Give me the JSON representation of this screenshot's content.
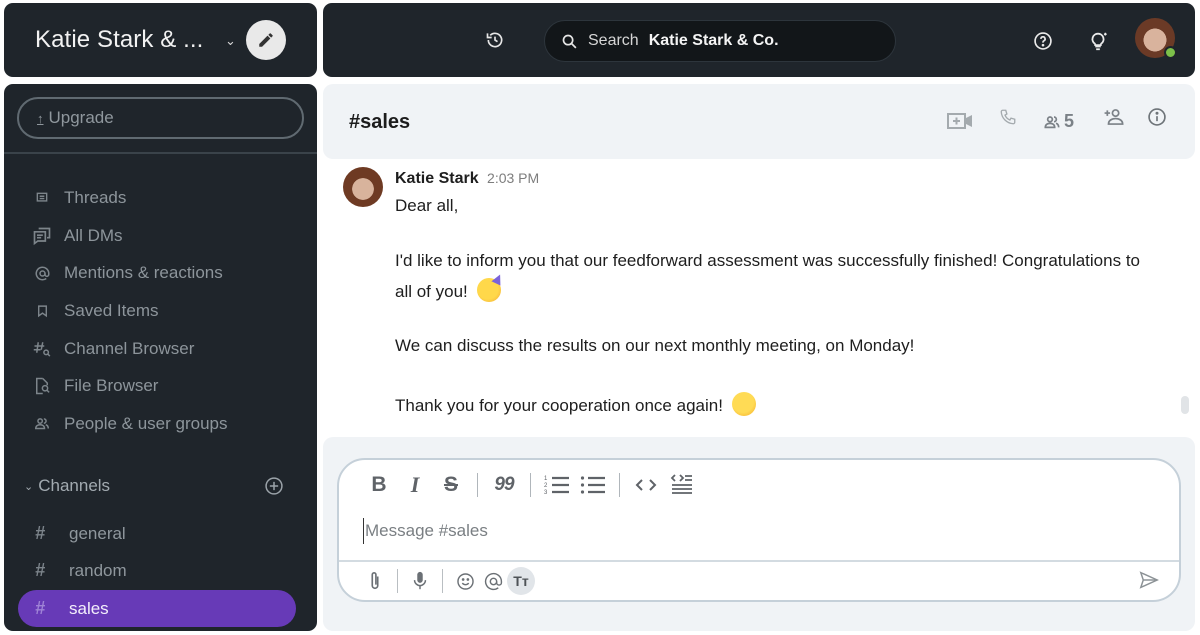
{
  "workspace": {
    "name": "Katie Stark & ...",
    "dropdown_icon": "chevron-down-icon",
    "edit_icon": "pencil-icon"
  },
  "topbar": {
    "history_icon": "history-icon",
    "search_label": "Search",
    "search_scope": "Katie Stark & Co.",
    "help_icon": "help-circle-icon",
    "whats_new_icon": "lightbulb-icon",
    "user_status": "online"
  },
  "sidebar": {
    "upgrade_label": "Upgrade",
    "nav_items": [
      {
        "label": "Threads",
        "icon": "threads-icon"
      },
      {
        "label": "All DMs",
        "icon": "direct-messages-icon"
      },
      {
        "label": "Mentions & reactions",
        "icon": "at-sign-icon"
      },
      {
        "label": "Saved Items",
        "icon": "bookmark-icon"
      },
      {
        "label": "Channel Browser",
        "icon": "channel-search-icon"
      },
      {
        "label": "File Browser",
        "icon": "file-search-icon"
      },
      {
        "label": "People & user groups",
        "icon": "people-icon"
      }
    ],
    "channels_header": "Channels",
    "channels": [
      {
        "hash": "#",
        "name": "general",
        "active": false
      },
      {
        "hash": "#",
        "name": "random",
        "active": false
      },
      {
        "hash": "#",
        "name": "sales",
        "active": true
      }
    ],
    "accent_color": "#673ab7"
  },
  "channel_header": {
    "title": "#sales",
    "member_count": "5",
    "icons": [
      "video-call-icon",
      "phone-icon",
      "members-icon",
      "add-member-icon",
      "info-icon"
    ]
  },
  "messages": [
    {
      "author": "Katie Stark",
      "time": "2:03 PM",
      "lines": [
        "Dear all,",
        "I'd like to inform you that our feedforward assessment was successfully finished! Congratulations to",
        "all of you!",
        "We can discuss the results on our next monthly meeting, on Monday!",
        "Thank you for your cooperation once again!"
      ],
      "emojis": [
        "partying-face",
        "smiling-face"
      ]
    }
  ],
  "composer": {
    "placeholder": "Message #sales",
    "value": "",
    "toolbar": [
      "bold",
      "italic",
      "strikethrough",
      "quote",
      "numbered-list",
      "bulleted-list",
      "code",
      "code-block"
    ],
    "toolbar_glyphs": {
      "bold": "B",
      "italic": "I",
      "strike": "S",
      "quote": "99"
    },
    "bottom": [
      "attach",
      "voice",
      "emoji",
      "mention",
      "formatting"
    ],
    "formatting_glyph": "Tт"
  }
}
